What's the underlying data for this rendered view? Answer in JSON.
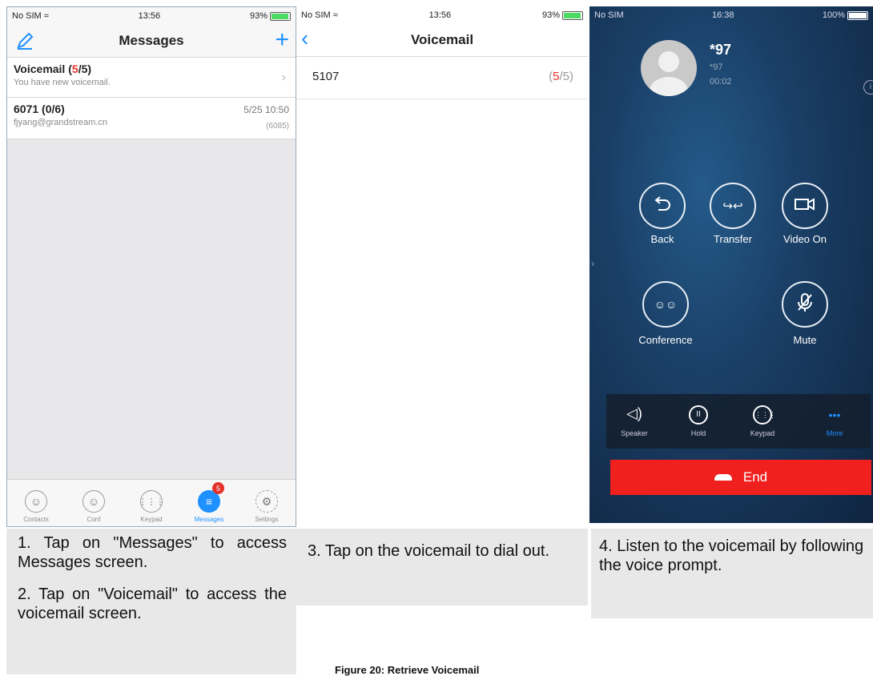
{
  "screen1": {
    "status": {
      "carrier": "No SIM",
      "time": "13:56",
      "battery": "93%"
    },
    "title": "Messages",
    "rows": [
      {
        "title_prefix": "Voicemail (",
        "title_count": "5",
        "title_suffix": "/5)",
        "subtitle": "You have new voicemail."
      },
      {
        "title": "6071 (0/6)",
        "subtitle": "fjyang@grandstream.cn",
        "date": "5/25 10:50",
        "extra": "(6085)"
      }
    ],
    "tabs": [
      {
        "label": "Contacts",
        "icon": "contacts-icon"
      },
      {
        "label": "Conf",
        "icon": "conference-icon"
      },
      {
        "label": "Keypad",
        "icon": "keypad-icon"
      },
      {
        "label": "Messages",
        "icon": "messages-icon",
        "badge": "5",
        "active": true
      },
      {
        "label": "Settings",
        "icon": "settings-icon"
      }
    ]
  },
  "screen2": {
    "status": {
      "carrier": "No SIM",
      "time": "13:56",
      "battery": "93%"
    },
    "title": "Voicemail",
    "row": {
      "number": "5107",
      "count_open": "(",
      "count_new": "5",
      "count_rest": "/5)"
    }
  },
  "screen3": {
    "status": {
      "carrier": "No SIM",
      "time": "16:38",
      "battery": "100%"
    },
    "caller": {
      "name": "*97",
      "number": "*97",
      "duration": "00:02"
    },
    "buttons": [
      {
        "label": "Back",
        "icon": "back-icon"
      },
      {
        "label": "Transfer",
        "icon": "transfer-icon"
      },
      {
        "label": "Video On",
        "icon": "video-icon"
      },
      {
        "label": "Conference",
        "icon": "conference-icon"
      },
      {
        "label": "Mute",
        "icon": "mute-icon"
      }
    ],
    "tools": [
      {
        "label": "Speaker",
        "icon": "speaker-icon"
      },
      {
        "label": "Hold",
        "icon": "hold-icon"
      },
      {
        "label": "Keypad",
        "icon": "keypad-icon"
      },
      {
        "label": "More",
        "icon": "more-icon"
      }
    ],
    "end_label": "End"
  },
  "captions": {
    "step1": "1. Tap on \"Messages\" to access Messages screen.",
    "step2": "2. Tap on \"Voicemail\" to access the voicemail screen.",
    "step3": "3. Tap on the voicemail to dial out.",
    "step4": "4. Listen to the voicemail by following the voice prompt.",
    "figure": "Figure 20: Retrieve Voicemail"
  },
  "colors": {
    "accent": "#1e90ff",
    "alert": "#e3312a",
    "end": "#f0201f"
  }
}
